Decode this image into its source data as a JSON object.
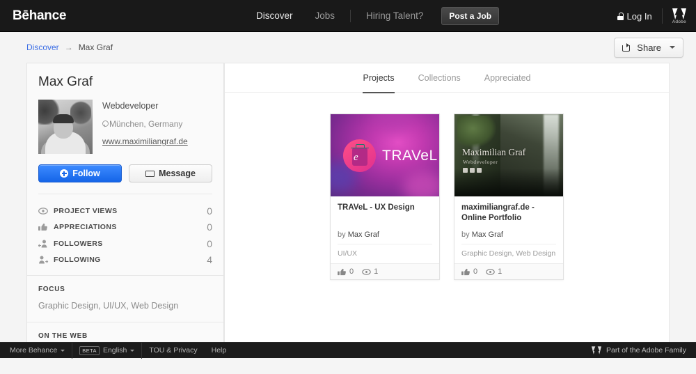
{
  "topnav": {
    "brand": "Bēhance",
    "links": [
      {
        "label": "Discover",
        "dim": false
      },
      {
        "label": "Jobs",
        "dim": true
      },
      {
        "label": "Hiring Talent?",
        "dim": true
      }
    ],
    "post_job_label": "Post a Job",
    "login_label": "Log In",
    "adobe_glyph": "◣◢",
    "adobe_word": "Adobe"
  },
  "breadcrumb": {
    "root": "Discover",
    "arrow": "→",
    "current": "Max Graf"
  },
  "share": {
    "label": "Share"
  },
  "profile": {
    "name": "Max Graf",
    "role": "Webdeveloper",
    "location": "München, Germany",
    "website": "www.maximiliangraf.de",
    "follow_label": "Follow",
    "message_label": "Message",
    "stats": [
      {
        "icon": "eye-icon",
        "label": "PROJECT VIEWS",
        "value": "0"
      },
      {
        "icon": "thumbs-up-icon",
        "label": "APPRECIATIONS",
        "value": "0"
      },
      {
        "icon": "followers-icon",
        "label": "FOLLOWERS",
        "value": "0"
      },
      {
        "icon": "following-icon",
        "label": "FOLLOWING",
        "value": "4"
      }
    ],
    "focus_title": "FOCUS",
    "focus_body": "Graphic Design, UI/UX, Web Design",
    "web_title": "ON THE WEB"
  },
  "tabs": [
    {
      "label": "Projects",
      "active": true
    },
    {
      "label": "Collections",
      "active": false
    },
    {
      "label": "Appreciated",
      "active": false
    }
  ],
  "projects": [
    {
      "thumb_word": "TRAVeL",
      "thumb_mark": "e",
      "title": "TRAVeL - UX Design",
      "by_prefix": "by",
      "author": "Max Graf",
      "tags": "UI/UX",
      "appreciations": "0",
      "views": "1"
    },
    {
      "thumb_title": "Maximilian Graf",
      "thumb_sub": "Webdeveloper",
      "title": "maximiliangraf.de - Online Portfolio",
      "by_prefix": "by",
      "author": "Max Graf",
      "tags": "Graphic Design, Web Design",
      "appreciations": "0",
      "views": "1"
    }
  ],
  "footer": {
    "more_behance": "More Behance",
    "beta": "BETA",
    "language": "English",
    "tou": "TOU & Privacy",
    "help": "Help",
    "adobe_family": "Part of the Adobe Family",
    "adobe_glyph": "◣◢"
  },
  "colors": {
    "accent_blue": "#1565e8",
    "link_blue": "#3c6ee5",
    "nav_dark": "#191919",
    "footer_dark": "#1c1c1c"
  }
}
